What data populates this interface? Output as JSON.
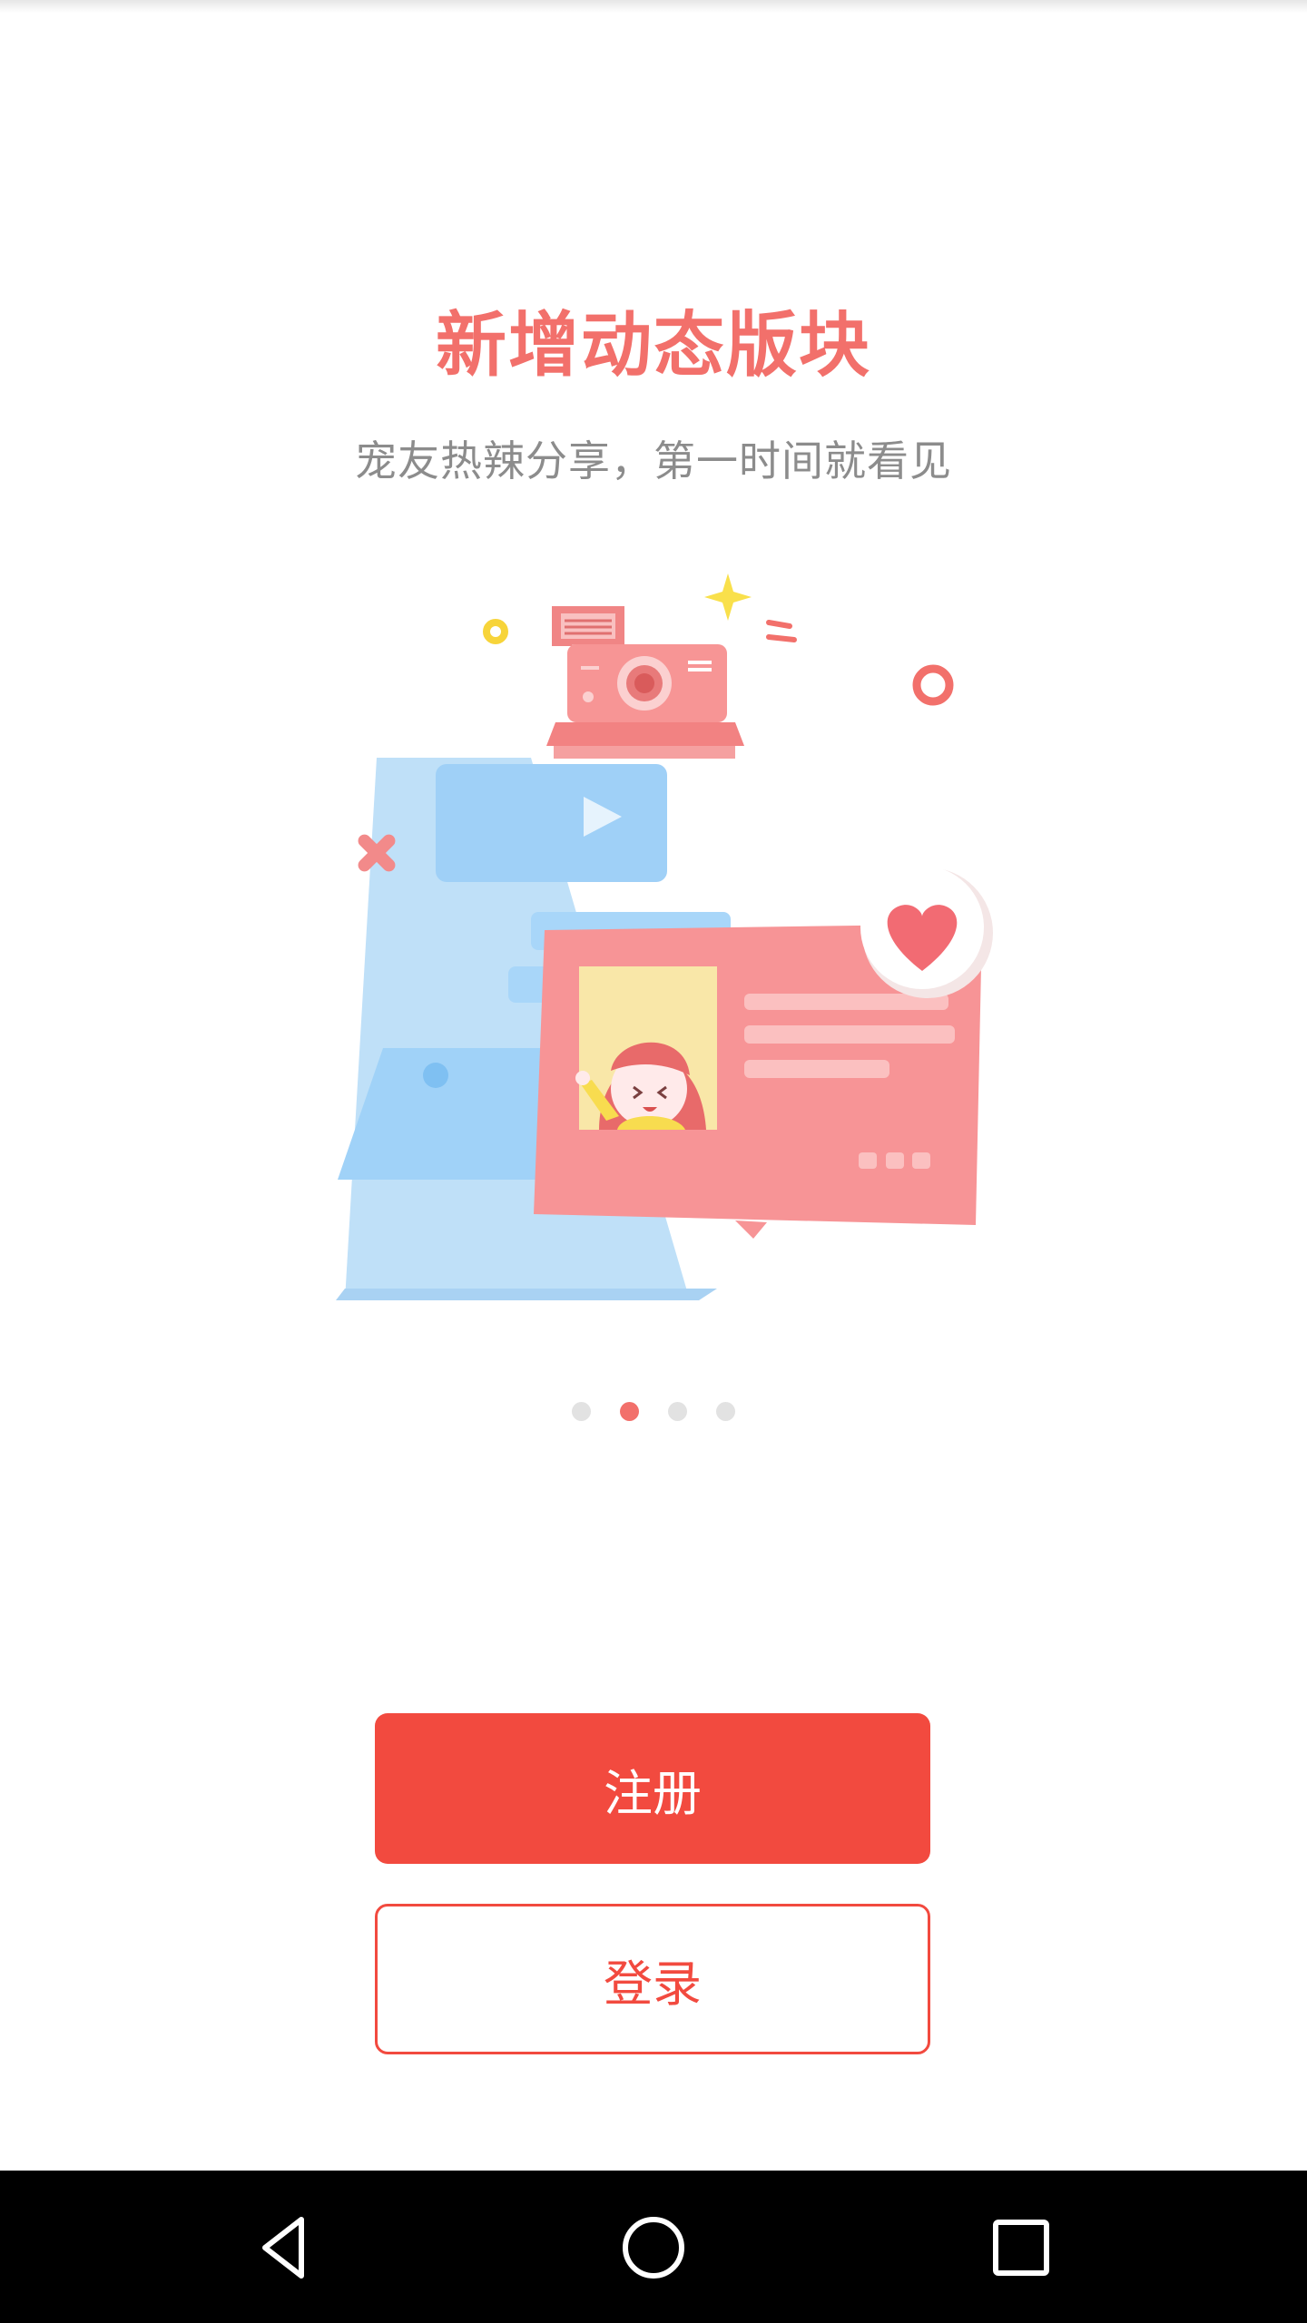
{
  "intro": {
    "title": "新增动态版块",
    "subtitle": "宠友热辣分享，第一时间就看见",
    "illustration": "camera-feed-illustration",
    "page_count": 4,
    "active_page": 2
  },
  "actions": {
    "register_label": "注册",
    "login_label": "登录"
  },
  "navbar": {
    "icons": [
      "back-icon",
      "home-icon",
      "recents-icon"
    ]
  },
  "colors": {
    "accent": "#f24a3f",
    "title": "#f2706b",
    "subtitle": "#8c8c8c",
    "dot_inactive": "#e2e2e2"
  }
}
